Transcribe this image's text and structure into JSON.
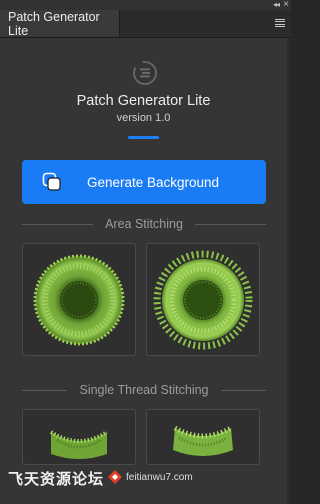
{
  "window": {
    "collapse_glyph": "◂◂",
    "close_glyph": "×"
  },
  "tab": {
    "label": "Patch Generator Lite"
  },
  "header": {
    "title": "Patch Generator Lite",
    "version": "version 1.0",
    "accent_color": "#1d7ff2"
  },
  "actions": {
    "generate_label": "Generate Background",
    "button_color": "#1a7cf5"
  },
  "sections": {
    "area": {
      "label": "Area Stitching"
    },
    "single": {
      "label": "Single Thread Stitching"
    }
  },
  "watermark": {
    "text": "飞天资源论坛",
    "url": "feitianwu7.com"
  }
}
